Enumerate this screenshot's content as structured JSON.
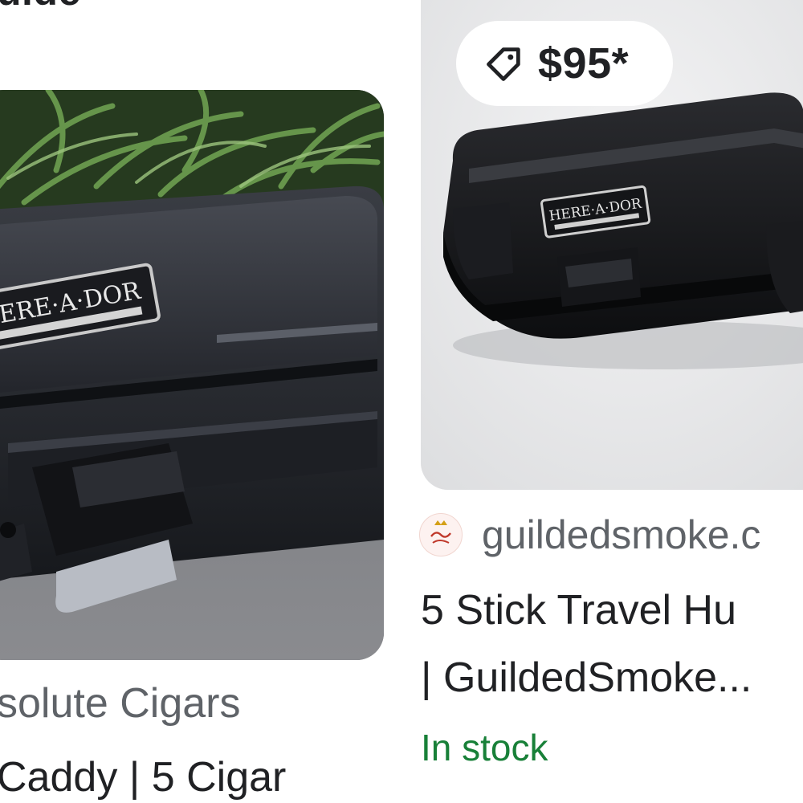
{
  "left_card": {
    "top_title_fragment": "uide",
    "image_alt": "Black Here-A-Dor travel humidor case on stone",
    "image_brand_label": "HERE·A·DOR",
    "source": "solute Cigars",
    "product_title": "Caddy | 5 Cigar"
  },
  "right_card": {
    "image_alt": "Black Here-A-Dor travel humidor case",
    "image_brand_label": "HERE·A·DOR",
    "price": "$95*",
    "price_icon": "tag-icon",
    "site_logo_icon": "guilded-smoke-logo",
    "site_name": "guildedsmoke.c",
    "product_title_line1": "5 Stick Travel Hu",
    "product_title_line2": "| GuildedSmoke...",
    "availability": "In stock"
  },
  "colors": {
    "text_primary": "#202124",
    "text_secondary": "#5f6368",
    "in_stock_green": "#188038",
    "chip_background": "#ffffff"
  }
}
